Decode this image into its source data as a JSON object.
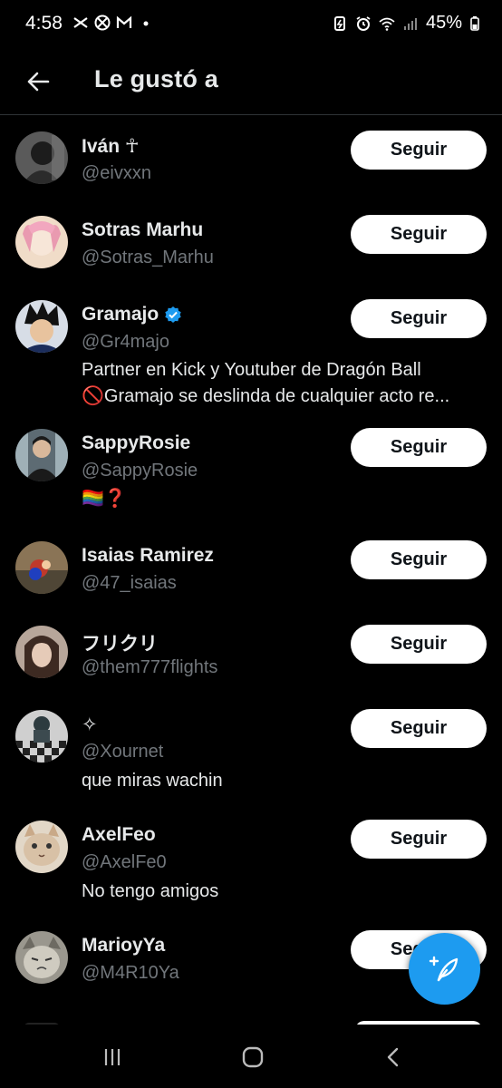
{
  "status_bar": {
    "time": "4:58",
    "battery": "45%",
    "left_icons": [
      "capcut-icon",
      "xbox-icon",
      "gmail-icon",
      "dot-icon"
    ],
    "right_icons": [
      "battery-saver-icon",
      "alarm-icon",
      "wifi-icon",
      "signal-icon",
      "battery-icon"
    ]
  },
  "header": {
    "title": "Le gustó a",
    "back_icon": "arrow-left-icon"
  },
  "follow_label": "Seguir",
  "users": [
    {
      "name": "Iván ☥",
      "handle": "@eivxxn",
      "verified": false,
      "bio": [],
      "avatar_color": "#3a3a3a"
    },
    {
      "name": "Sotras Marhu",
      "handle": "@Sotras_Marhu",
      "verified": false,
      "bio": [],
      "avatar_color": "#e8c9b0"
    },
    {
      "name": "Gramajo",
      "handle": "@Gr4majo",
      "verified": true,
      "bio": [
        "Partner en Kick y Youtuber de Dragón Ball",
        "🚫Gramajo se deslinda de cualquier acto re..."
      ],
      "avatar_color": "#2a3140"
    },
    {
      "name": "SappyRosie",
      "handle": "@SappyRosie",
      "verified": false,
      "bio": [
        "🏳️‍🌈❓"
      ],
      "avatar_color": "#4a5560"
    },
    {
      "name": "Isaias Ramirez",
      "handle": "@47_isaias",
      "verified": false,
      "bio": [],
      "avatar_color": "#6b5a40"
    },
    {
      "name": "フリクリ",
      "handle": "@them777flights",
      "verified": false,
      "bio": [],
      "avatar_color": "#7a6258"
    },
    {
      "name": "✧",
      "handle": "@Xournet",
      "verified": false,
      "bio": [
        "que miras wachin"
      ],
      "avatar_color": "#555555"
    },
    {
      "name": "AxelFeo",
      "handle": "@AxelFe0",
      "verified": false,
      "bio": [
        "No tengo amigos"
      ],
      "avatar_color": "#c9b8a3"
    },
    {
      "name": "MarioyYa",
      "handle": "@M4R10Ya",
      "verified": false,
      "bio": [],
      "avatar_color": "#8e8e86"
    }
  ],
  "fab_icon": "compose-post-icon",
  "nav_bar": {
    "icons": [
      "recent-apps-icon",
      "home-icon",
      "back-icon"
    ]
  },
  "colors": {
    "background": "#000000",
    "primary_text": "#e7e9ea",
    "secondary_text": "#71767b",
    "accent": "#1d9bf0",
    "divider": "#2f3336"
  }
}
